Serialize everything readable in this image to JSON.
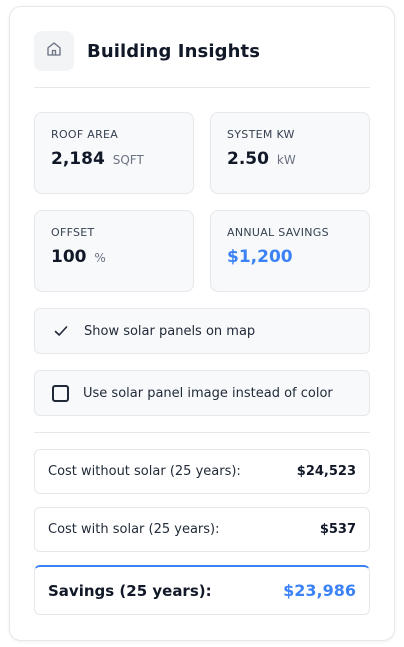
{
  "header": {
    "title": "Building Insights",
    "icon": "home-icon"
  },
  "stats": {
    "roof_area": {
      "label": "ROOF AREA",
      "value": "2,184",
      "unit": "SQFT"
    },
    "system_kw": {
      "label": "SYSTEM KW",
      "value": "2.50",
      "unit": "kW"
    },
    "offset": {
      "label": "OFFSET",
      "value": "100",
      "unit": "%"
    },
    "annual_savings": {
      "label": "ANNUAL SAVINGS",
      "value": "$1,200"
    }
  },
  "toggles": {
    "show_panels": {
      "label": "Show solar panels on map",
      "checked": true
    },
    "use_image": {
      "label": "Use solar panel image instead of color",
      "checked": false
    }
  },
  "costs": {
    "without_solar": {
      "label": "Cost without solar (25 years):",
      "value": "$24,523"
    },
    "with_solar": {
      "label": "Cost with solar (25 years):",
      "value": "$537"
    },
    "savings": {
      "label": "Savings (25 years):",
      "value": "$23,986"
    }
  },
  "colors": {
    "accent": "#3b82f6",
    "card_bg": "#f8f9fb",
    "border": "#e5e7eb"
  }
}
